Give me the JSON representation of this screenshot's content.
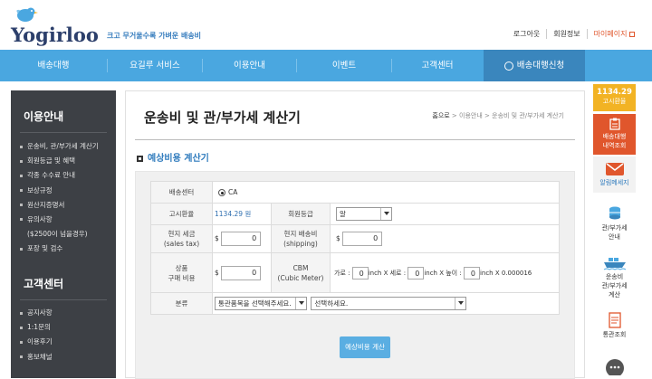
{
  "header": {
    "logo_text": "Yogirloo",
    "slogan": "크고 무거울수록 가벼운 배송비",
    "links": [
      "로그아웃",
      "회원정보",
      "마이페이지"
    ]
  },
  "nav": {
    "items": [
      "배송대행",
      "요길루 서비스",
      "이용안내",
      "이벤트",
      "고객센터"
    ],
    "apply": "배송대행신청"
  },
  "sidebar": {
    "section1_title": "이용안내",
    "section1_items": [
      "운송비, 관/부가세 계산기",
      "회원등급 및 혜택",
      "각종 수수료 안내",
      "보상규정",
      "원산지증명서",
      "유의사항",
      "($2500이 넘을경우)",
      "포장 및 검수"
    ],
    "section2_title": "고객센터",
    "section2_items": [
      "공지사항",
      "1:1문의",
      "이용후기",
      "홍보채널"
    ]
  },
  "main": {
    "title": "운송비 및 관/부가세 계산기",
    "breadcrumb": [
      "홈으로",
      "이용안내",
      "운송비 및 관/부가세 계산기"
    ],
    "subtitle": "예상비용 계산기",
    "form": {
      "center_label": "배송센터",
      "center_value": "CA",
      "rate_label": "고시환율",
      "rate_value": "1134.29 원",
      "grade_label": "회원등급",
      "grade_value": "알",
      "sales_tax_label_1": "현지 세금",
      "sales_tax_label_2": "(sales tax)",
      "sales_tax_currency": "$",
      "sales_tax_value": "0",
      "shipping_label_1": "현지 배송비",
      "shipping_label_2": "(shipping)",
      "shipping_currency": "$",
      "shipping_value": "0",
      "product_label_1": "상품",
      "product_label_2": "구매 비용",
      "product_currency": "$",
      "product_value": "0",
      "cbm_label_1": "CBM",
      "cbm_label_2": "(Cubic Meter)",
      "width_label": "가로 :",
      "width_value": "0",
      "length_label": "inch X 세로 :",
      "length_value": "0",
      "height_label": "inch X 높이 :",
      "height_value": "0",
      "cbm_suffix": "inch X 0.000016",
      "category_label": "분류",
      "category_select_1": "통관품목을 선택해주세요.",
      "category_select_2": "선택하세요.",
      "calc_button": "예상비용 계산"
    }
  },
  "quickbar": {
    "rate_value": "1134.29",
    "rate_label": "고시환율",
    "items": [
      {
        "label_1": "배송대행",
        "label_2": "내역조회",
        "icon": "clipboard-icon"
      },
      {
        "label_1": "알림메세지",
        "label_2": "",
        "icon": "mail-icon"
      },
      {
        "label_1": "관/부가세",
        "label_2": "안내",
        "icon": "coins-icon"
      },
      {
        "label_1": "운송비",
        "label_2": "관/부가세",
        "label_3": "계산",
        "icon": "ship-icon"
      },
      {
        "label_1": "통관조회",
        "label_2": "",
        "icon": "document-icon"
      }
    ]
  },
  "colors": {
    "nav_blue": "#4aa7e0",
    "accent_orange": "#e0562c",
    "rate_yellow": "#f2b324",
    "sidebar_dark": "#3d4045"
  }
}
